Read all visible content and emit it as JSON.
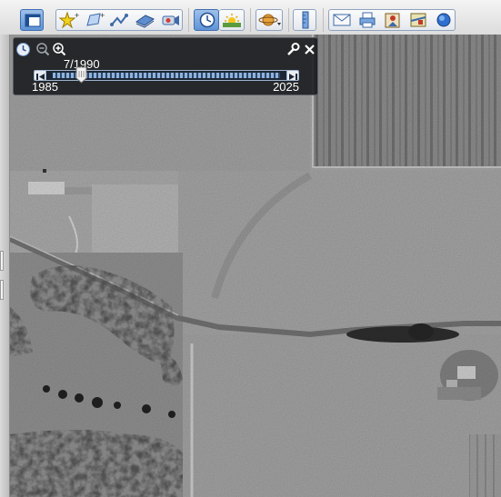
{
  "toolbar": {
    "buttons": [
      {
        "name": "sidebar-toggle-button",
        "icon": "sidebar-icon",
        "active": true
      },
      {
        "name": "add-placemark-button",
        "icon": "pushpin-star-icon"
      },
      {
        "name": "add-polygon-button",
        "icon": "polygon-icon"
      },
      {
        "name": "add-path-button",
        "icon": "path-icon"
      },
      {
        "name": "add-image-overlay-button",
        "icon": "image-overlay-icon"
      },
      {
        "name": "record-tour-button",
        "icon": "record-tour-icon"
      },
      {
        "name": "historical-imagery-button",
        "icon": "clock-icon",
        "active": true
      },
      {
        "name": "sunlight-button",
        "icon": "sun-icon"
      },
      {
        "name": "planets-button",
        "icon": "planet-icon"
      },
      {
        "name": "ruler-button",
        "icon": "ruler-icon"
      },
      {
        "name": "email-button",
        "icon": "envelope-icon"
      },
      {
        "name": "print-button",
        "icon": "printer-icon"
      },
      {
        "name": "save-image-button",
        "icon": "save-image-icon"
      },
      {
        "name": "view-in-maps-button",
        "icon": "map-icon"
      },
      {
        "name": "earth-button",
        "icon": "globe-icon"
      }
    ]
  },
  "time_slider": {
    "current_date": "7/1990",
    "start_year": "1985",
    "end_year": "2025",
    "position_fraction": 0.13,
    "icons": [
      "clock-icon",
      "zoom-out-icon",
      "zoom-in-icon",
      "wrench-icon",
      "close-icon",
      "skip-back-icon",
      "skip-forward-icon"
    ]
  },
  "colors": {
    "panel_bg": "#16181c",
    "toolbar_active": "#5f93d6",
    "slider_track": "#8fb3dd"
  }
}
